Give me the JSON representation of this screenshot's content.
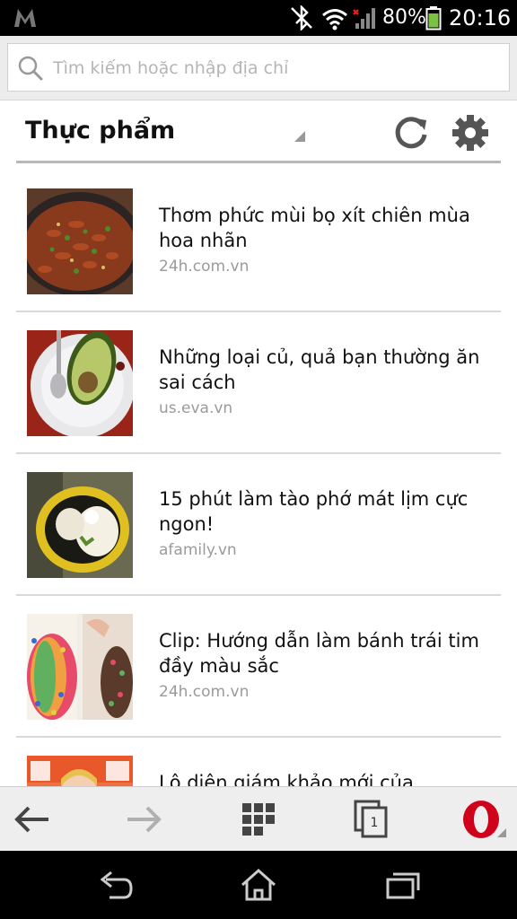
{
  "status_bar": {
    "battery_percent": "80%",
    "time": "20:16"
  },
  "search": {
    "placeholder": "Tìm kiếm hoặc nhập địa chỉ"
  },
  "category": {
    "title": "Thực phẩm"
  },
  "news_items": [
    {
      "title": "Thơm phức mùi bọ xít chiên mùa hoa nhãn",
      "source": "24h.com.vn"
    },
    {
      "title": "Những loại củ, quả bạn thường ăn sai cách",
      "source": "us.eva.vn"
    },
    {
      "title": "15 phút làm tào phớ mát lịm cực ngon!",
      "source": "afamily.vn"
    },
    {
      "title": "Clip: Hướng dẫn làm bánh trái tim đầy màu sắc",
      "source": "24h.com.vn"
    },
    {
      "title": "Lộ diện giám khảo mới của",
      "source": ""
    }
  ],
  "browser_bar": {
    "tab_count": "1",
    "icons": [
      "back-arrow-icon",
      "forward-arrow-icon",
      "speed-dial-grid-icon",
      "tabs-icon",
      "opera-menu-icon"
    ]
  },
  "colors": {
    "status_bar_bg": "#000000",
    "opera_red": "#d0021b",
    "source_gray": "#9a9a9a"
  }
}
